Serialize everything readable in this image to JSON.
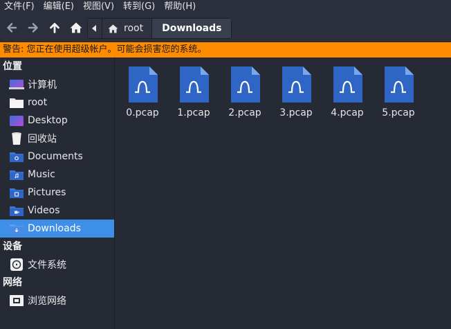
{
  "menu": [
    "文件(F)",
    "编辑(E)",
    "视图(V)",
    "转到(G)",
    "帮助(H)"
  ],
  "toolbar": {
    "back_icon": "arrow-left-icon",
    "forward_icon": "arrow-right-icon",
    "up_icon": "arrow-up-icon",
    "home_icon": "home-icon"
  },
  "path": {
    "root_label": "root",
    "current_label": "Downloads"
  },
  "warning": "警告: 您正在使用超级帐户。可能会损害您的系统。",
  "sidebar": {
    "places_title": "位置",
    "places": [
      {
        "label": "计算机",
        "icon": "computer-icon"
      },
      {
        "label": "root",
        "icon": "home-folder-icon"
      },
      {
        "label": "Desktop",
        "icon": "desktop-icon"
      },
      {
        "label": "回收站",
        "icon": "trash-icon"
      },
      {
        "label": "Documents",
        "icon": "documents-folder-icon"
      },
      {
        "label": "Music",
        "icon": "music-folder-icon"
      },
      {
        "label": "Pictures",
        "icon": "pictures-folder-icon"
      },
      {
        "label": "Videos",
        "icon": "videos-folder-icon"
      },
      {
        "label": "Downloads",
        "icon": "downloads-folder-icon"
      }
    ],
    "devices_title": "设备",
    "devices": [
      {
        "label": "文件系统",
        "icon": "drive-icon"
      }
    ],
    "network_title": "网络",
    "network": [
      {
        "label": "浏览网络",
        "icon": "network-icon"
      }
    ]
  },
  "files": [
    {
      "name": "0.pcap",
      "icon": "pcap-file-icon"
    },
    {
      "name": "1.pcap",
      "icon": "pcap-file-icon"
    },
    {
      "name": "2.pcap",
      "icon": "pcap-file-icon"
    },
    {
      "name": "3.pcap",
      "icon": "pcap-file-icon"
    },
    {
      "name": "4.pcap",
      "icon": "pcap-file-icon"
    },
    {
      "name": "5.pcap",
      "icon": "pcap-file-icon"
    }
  ],
  "colors": {
    "accent": "#3d8fe8",
    "warning": "#ff8c00",
    "background": "#262a35",
    "file_icon": "#2f66c5"
  }
}
